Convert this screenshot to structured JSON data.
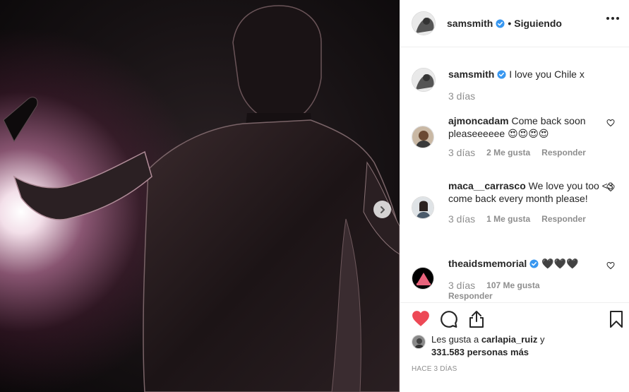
{
  "post": {
    "author": "samsmith",
    "follow_sep": "•",
    "follow_label": "Siguiendo",
    "caption": {
      "username": "samsmith",
      "text": "I love you Chile x",
      "time": "3 días"
    }
  },
  "comments": [
    {
      "username": "ajmoncadam",
      "text": "Come back soon pleaseeeeee 😍😍😍😍",
      "time": "3 días",
      "likes": "2 Me gusta",
      "reply": "Responder"
    },
    {
      "username": "maca__carrasco",
      "text": "We love you too <3 come back every month please!",
      "time": "3 días",
      "likes": "1 Me gusta",
      "reply": "Responder"
    },
    {
      "username": "theaidsmemorial",
      "text": "🖤🖤🖤",
      "time": "3 días",
      "likes": "107 Me gusta",
      "reply": "Responder"
    }
  ],
  "likes": {
    "prefix": "Les gusta a ",
    "user": "carlapia_ruiz",
    "connector": " y",
    "count": "331.583 personas más"
  },
  "timestamp": "HACE 3 DÍAS",
  "colors": {
    "like_red": "#ed4956",
    "verified_blue": "#3897f0",
    "muted": "#8e8e8e"
  },
  "icons": {
    "like": "heart-filled-icon",
    "comment": "comment-bubble-icon",
    "share": "share-icon",
    "save": "bookmark-icon",
    "next": "chevron-right-icon"
  }
}
